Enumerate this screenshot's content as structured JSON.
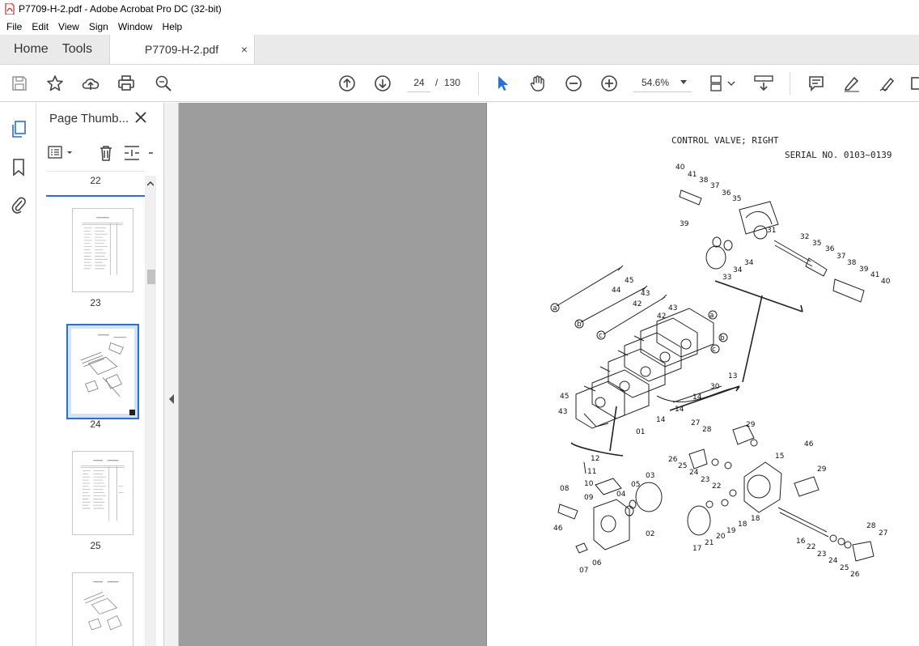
{
  "window": {
    "title": "P7709-H-2.pdf - Adobe Acrobat Pro DC (32-bit)"
  },
  "menu": [
    "File",
    "Edit",
    "View",
    "Sign",
    "Window",
    "Help"
  ],
  "tabs": {
    "home": "Home",
    "tools": "Tools",
    "document": "P7709-H-2.pdf",
    "close": "×"
  },
  "toolbar": {
    "page_current": "24",
    "page_separator": "/",
    "page_total": "130",
    "zoom": "54.6%"
  },
  "panel": {
    "title": "Page Thumb...",
    "thumbnails": [
      {
        "label": "22"
      },
      {
        "label": "23"
      },
      {
        "label": "24",
        "selected": true
      },
      {
        "label": "25"
      }
    ]
  },
  "document": {
    "heading": "CONTROL VALVE; RIGHT",
    "serial": "SERIAL NO. 0103~0139",
    "callouts": [
      "40",
      "41",
      "38",
      "37",
      "36",
      "35",
      "39",
      "31",
      "32",
      "35",
      "36",
      "37",
      "38",
      "39",
      "41",
      "40",
      "34",
      "34",
      "33",
      "45",
      "44",
      "43",
      "42",
      "42",
      "43",
      "13",
      "30",
      "14",
      "14",
      "14",
      "45",
      "43",
      "01",
      "12",
      "11",
      "10",
      "09",
      "08",
      "04",
      "05",
      "03",
      "46",
      "02",
      "06",
      "07",
      "27",
      "28",
      "29",
      "46",
      "26",
      "25",
      "24",
      "23",
      "22",
      "15",
      "29",
      "18",
      "18",
      "19",
      "20",
      "21",
      "17",
      "16",
      "22",
      "23",
      "24",
      "25",
      "26",
      "28",
      "27"
    ]
  },
  "icons": {
    "save": "save-icon",
    "star": "bookmark-star-icon",
    "upload": "share-upload-icon",
    "print": "print-icon",
    "search": "zoom-search-icon",
    "prev": "previous-page-icon",
    "next": "next-page-icon",
    "select": "select-arrow-icon",
    "hand": "hand-pan-icon",
    "zoomout": "zoom-out-icon",
    "zoomin": "zoom-in-icon"
  },
  "colors": {
    "accent": "#2b6fd6",
    "pdf_red": "#d7262d",
    "canvas": "#9d9d9d"
  }
}
